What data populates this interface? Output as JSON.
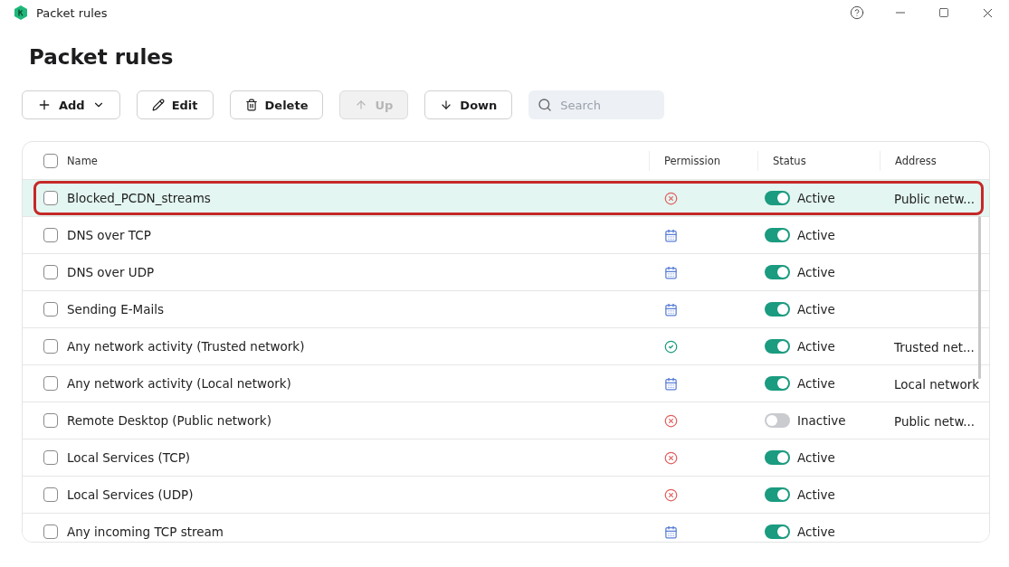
{
  "window": {
    "title": "Packet rules"
  },
  "heading": "Packet rules",
  "toolbar": [
    {
      "kind": "add",
      "label": "Add",
      "disabled": false
    },
    {
      "kind": "edit",
      "label": "Edit",
      "disabled": false
    },
    {
      "kind": "delete",
      "label": "Delete",
      "disabled": false
    },
    {
      "kind": "up",
      "label": "Up",
      "disabled": true
    },
    {
      "kind": "down",
      "label": "Down",
      "disabled": false
    }
  ],
  "search": {
    "placeholder": "Search"
  },
  "table": {
    "columns": [
      "Name",
      "Permission",
      "Status",
      "Address"
    ],
    "all_checked": false,
    "rows": [
      {
        "name": "Blocked_PCDN_streams",
        "kind": "block",
        "active": true,
        "status": "Active",
        "address": "Public netw...",
        "checked": false,
        "selected": true,
        "highlighted": true
      },
      {
        "name": "DNS over TCP",
        "kind": "schedule",
        "active": true,
        "status": "Active",
        "checked": false,
        "selected": false,
        "highlighted": false
      },
      {
        "name": "DNS over UDP",
        "kind": "schedule",
        "active": true,
        "status": "Active",
        "checked": false,
        "selected": false,
        "highlighted": false
      },
      {
        "name": "Sending E-Mails",
        "kind": "schedule",
        "active": true,
        "status": "Active",
        "checked": false,
        "selected": false,
        "highlighted": false
      },
      {
        "name": "Any network activity (Trusted network)",
        "kind": "allow",
        "active": true,
        "status": "Active",
        "address": "Trusted net...",
        "checked": false,
        "selected": false,
        "highlighted": false
      },
      {
        "name": "Any network activity (Local network)",
        "kind": "schedule",
        "active": true,
        "status": "Active",
        "address": "Local network",
        "checked": false,
        "selected": false,
        "highlighted": false
      },
      {
        "name": "Remote Desktop (Public network)",
        "kind": "block",
        "active": false,
        "status": "Inactive",
        "address": "Public netw...",
        "checked": false,
        "selected": false,
        "highlighted": false
      },
      {
        "name": "Local Services (TCP)",
        "kind": "block",
        "active": true,
        "status": "Active",
        "checked": false,
        "selected": false,
        "highlighted": false
      },
      {
        "name": "Local Services (UDP)",
        "kind": "block",
        "active": true,
        "status": "Active",
        "checked": false,
        "selected": false,
        "highlighted": false
      },
      {
        "name": "Any incoming TCP stream",
        "kind": "schedule",
        "active": true,
        "status": "Active",
        "checked": false,
        "selected": false,
        "highlighted": false
      }
    ]
  }
}
